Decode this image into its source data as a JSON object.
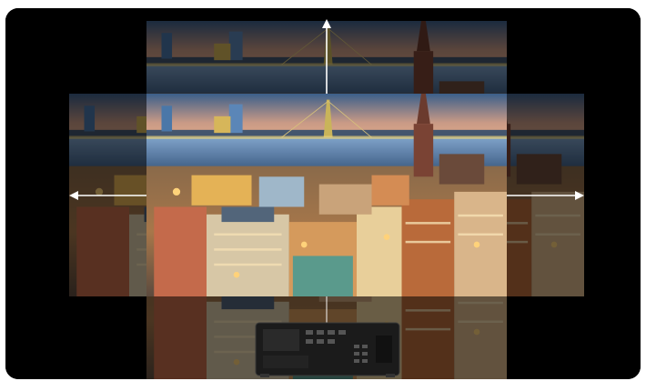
{
  "scene": {
    "description_icons": [
      "up-arrow-icon",
      "left-arrow-icon",
      "right-arrow-icon"
    ],
    "colors": {
      "background": "#000000",
      "arrow": "#ffffff",
      "sky_top": "#3b5f8a",
      "sky_bottom": "#e9b28a",
      "water": "#5d84b3",
      "city_light": "#e0a75a",
      "projector_body": "#1b1b1b"
    }
  }
}
